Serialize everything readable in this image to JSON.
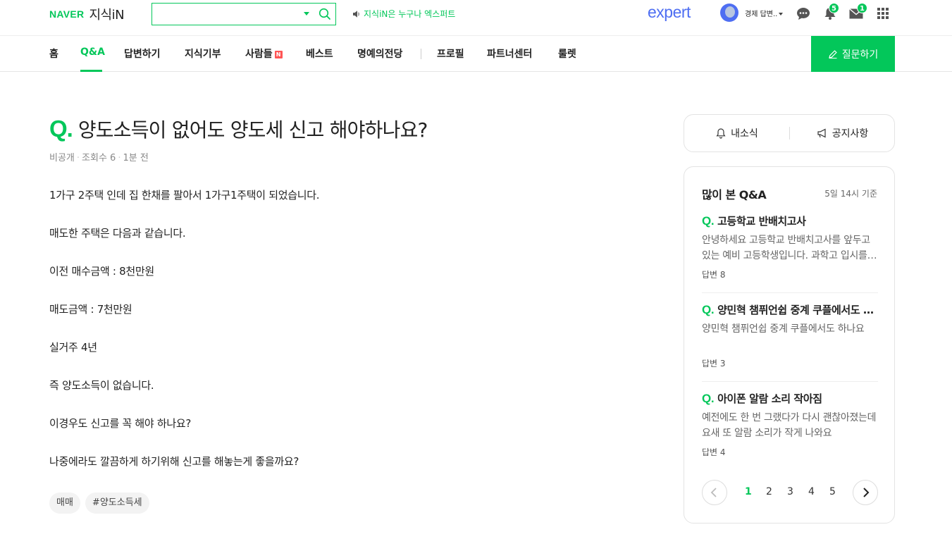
{
  "header": {
    "brand": "NAVER",
    "service": "지식iN",
    "search_placeholder": "",
    "notice": "지식iN은 누구나 엑스퍼트",
    "expert_logo": "expert",
    "user_name": "경제 답변..",
    "notifications_count": "5",
    "mail_count": "1"
  },
  "nav": {
    "items": [
      "홈",
      "Q&A",
      "답변하기",
      "지식기부",
      "사람들",
      "베스트",
      "명예의전당",
      "프로필",
      "파트너센터",
      "룰렛"
    ],
    "active": "Q&A",
    "new_badge": "N",
    "ask_button": "질문하기"
  },
  "question": {
    "mark": "Q.",
    "title": "양도소득이 없어도 양도세 신고 해야하나요?",
    "visibility": "비공개",
    "views": "조회수 6",
    "time": "1분 전",
    "paragraphs": [
      "1가구 2주택 인데 집 한채를 팔아서 1가구1주택이 되었습니다.",
      "매도한 주택은 다음과 같습니다.",
      "이전 매수금액 : 8천만원",
      "매도금액 : 7천만원",
      "실거주 4년",
      "즉 양도소득이 없습니다.",
      "이경우도 신고를 꼭 해야 하나요?",
      "나중에라도 깔끔하게 하기위해 신고를 해놓는게 좋을까요?"
    ],
    "tags": [
      "매매",
      "#양도소득세"
    ]
  },
  "side": {
    "my_news": "내소식",
    "notices": "공지사항",
    "popular_title": "많이 본 Q&A",
    "popular_time": "5일 14시 기준",
    "qa_mark": "Q.",
    "qa": [
      {
        "title": "고등학교 반배치고사",
        "snippet": "안녕하세요 고등학교 반배치고사를 앞두고 있는 예비 고등학생입니다. 과학고 입시를 준비하다가",
        "answers": "답변 8"
      },
      {
        "title": "양민혁 챔퓌언쉽 중계 쿠플에서도 하나요",
        "snippet": "양민혁 챔퓌언쉽 중계 쿠플에서도 하나요",
        "answers": "답변 3"
      },
      {
        "title": "아이폰 알람 소리 작아짐",
        "snippet": "예전에도 한 번 그랬다가 다시 괜찮아졌는데 요새 또 알람 소리가 작게 나와요",
        "answers": "답변 4"
      }
    ],
    "pages": [
      "1",
      "2",
      "3",
      "4",
      "5"
    ],
    "current_page": "1"
  },
  "colors": {
    "brand_green": "#03c75a",
    "expert_blue": "#4e6ef2"
  },
  "icons": [
    "search-icon",
    "speaker-icon",
    "chat-icon",
    "bell-icon",
    "mail-icon",
    "grid-menu-icon",
    "pencil-icon",
    "chevron-left-icon",
    "chevron-right-icon"
  ]
}
